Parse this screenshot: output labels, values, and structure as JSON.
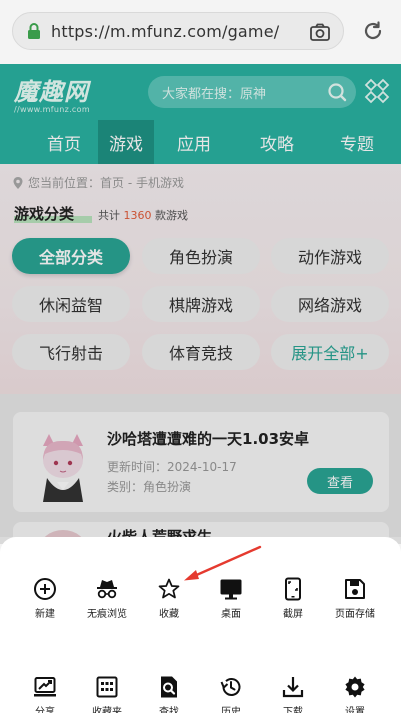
{
  "browser": {
    "url": "https://m.mfunz.com/game/"
  },
  "site": {
    "logo_text": "魔趣网",
    "logo_sub": "//www.mfunz.com",
    "search_placeholder": "大家都在搜：原神",
    "nav": [
      "首页",
      "游戏",
      "应用",
      "攻略",
      "专题"
    ],
    "active_nav": "游戏"
  },
  "breadcrumb": "您当前位置：首页 - 手机游戏",
  "category": {
    "title": "游戏分类",
    "count_prefix": "共计",
    "count_value": "1360",
    "count_suffix": "款游戏",
    "pills": [
      {
        "label": "全部分类",
        "active": true
      },
      {
        "label": "角色扮演"
      },
      {
        "label": "动作游戏"
      },
      {
        "label": "休闲益智"
      },
      {
        "label": "棋牌游戏"
      },
      {
        "label": "网络游戏"
      },
      {
        "label": "飞行射击"
      },
      {
        "label": "体育竞技"
      },
      {
        "label": "展开全部+",
        "more": true
      }
    ]
  },
  "games": [
    {
      "title": "沙哈塔遭遭难的一天1.03安卓",
      "update_label": "更新时间：",
      "update": "2024-10-17",
      "category_label": "类别：",
      "category": "角色扮演",
      "button": "查看"
    },
    {
      "title": "火柴人荒野求生"
    }
  ],
  "menu": {
    "row1": [
      {
        "icon": "new-tab-icon",
        "label": "新建"
      },
      {
        "icon": "incognito-icon",
        "label": "无痕浏览"
      },
      {
        "icon": "star-icon",
        "label": "收藏"
      },
      {
        "icon": "desktop-icon",
        "label": "桌面"
      },
      {
        "icon": "screenshot-icon",
        "label": "截屏"
      },
      {
        "icon": "save-page-icon",
        "label": "页面存储"
      }
    ],
    "row2": [
      {
        "icon": "share-icon",
        "label": "分享"
      },
      {
        "icon": "bookmarks-icon",
        "label": "收藏夹"
      },
      {
        "icon": "find-icon",
        "label": "查找"
      },
      {
        "icon": "history-icon",
        "label": "历史"
      },
      {
        "icon": "download-icon",
        "label": "下载"
      },
      {
        "icon": "settings-icon",
        "label": "设置"
      }
    ]
  },
  "colors": {
    "brand": "#2ab3a2",
    "accent": "#2aa595",
    "count": "#e25c3a",
    "arrow": "#e53a2f"
  }
}
